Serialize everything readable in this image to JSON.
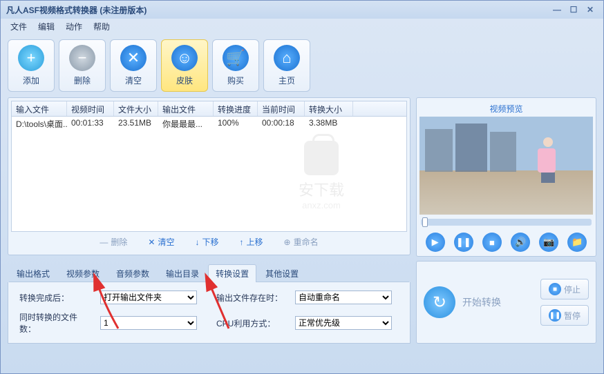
{
  "title": "凡人ASF视频格式转换器  (未注册版本)",
  "menu": [
    "文件",
    "编辑",
    "动作",
    "帮助"
  ],
  "toolbar": [
    {
      "label": "添加",
      "icon": "plus"
    },
    {
      "label": "删除",
      "icon": "minus"
    },
    {
      "label": "清空",
      "icon": "x"
    },
    {
      "label": "皮肤",
      "icon": "smile",
      "highlight": true
    },
    {
      "label": "购买",
      "icon": "cart"
    },
    {
      "label": "主页",
      "icon": "home"
    }
  ],
  "table": {
    "headers": [
      "输入文件",
      "视频时间",
      "文件大小",
      "输出文件",
      "转换进度",
      "当前时间",
      "转换大小"
    ],
    "rows": [
      [
        "D:\\tools\\桌面...",
        "00:01:33",
        "23.51MB",
        "你最最最...",
        "100%",
        "00:00:18",
        "3.38MB"
      ]
    ]
  },
  "watermark": {
    "line1": "安下载",
    "line2": "anxz.com"
  },
  "actions": {
    "delete": "删除",
    "clear": "清空",
    "down": "下移",
    "up": "上移",
    "rename": "重命名"
  },
  "tabs": [
    "输出格式",
    "视频参数",
    "音频参数",
    "输出目录",
    "转换设置",
    "其他设置"
  ],
  "activeTab": 4,
  "settings": {
    "after_label": "转换完成后：",
    "after_value": "打开输出文件夹",
    "exist_label": "输出文件存在时：",
    "exist_value": "自动重命名",
    "files_label": "同时转换的文件数：",
    "files_value": "1",
    "cpu_label": "CPU利用方式：",
    "cpu_value": "正常优先级"
  },
  "preview": {
    "title": "视频预览"
  },
  "convert": {
    "start": "开始转换",
    "stop": "停止",
    "pause": "暂停"
  }
}
